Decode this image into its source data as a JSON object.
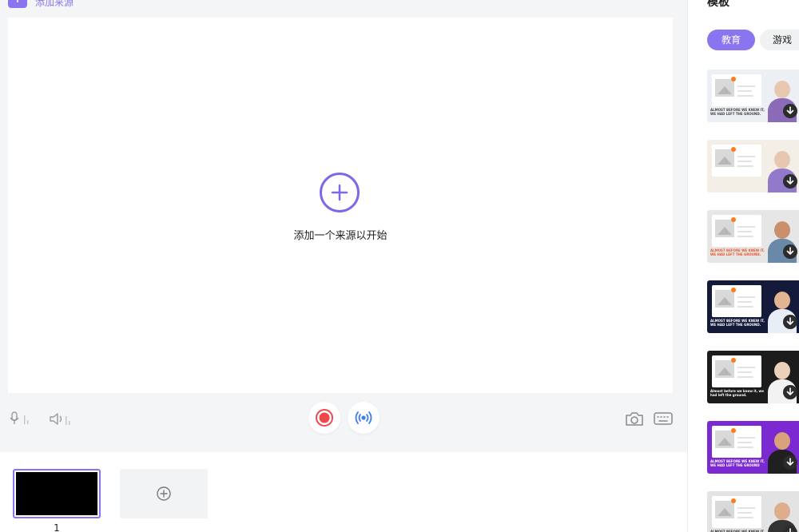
{
  "top": {
    "add_source_label": "添加来源"
  },
  "canvas": {
    "hint": "添加一个来源以开始"
  },
  "scenes": [
    {
      "number": "1"
    }
  ],
  "right_panel": {
    "title": "模板",
    "tabs": [
      {
        "label": "教育",
        "active": true
      },
      {
        "label": "游戏",
        "active": false
      }
    ],
    "templates": [
      {
        "bg": "#eceff3",
        "caption": "ALMOST BEFORE WE KNEW IT, WE HAD LEFT THE GROUND.",
        "caption_color": "#444",
        "skin": "#e8c9b0",
        "shirt": "#8b6bb8"
      },
      {
        "bg": "#f3efe6",
        "caption": "",
        "caption_color": "#444",
        "skin": "#e6c8b2",
        "shirt": "#9279c9"
      },
      {
        "bg": "#e6e6e6",
        "caption": "ALMOST BEFORE WE KNEW IT, WE HAD LEFT THE GROUND.",
        "caption_color": "#e8572b",
        "skin": "#c9906b",
        "shirt": "#6a88a8"
      },
      {
        "bg": "#141a3a",
        "caption": "ALMOST BEFORE WE KNEW IT, WE HAD LEFT THE GROUND.",
        "caption_color": "#ffffff",
        "skin": "#e1b591",
        "shirt": "#e9eef6"
      },
      {
        "bg": "#1c1c1c",
        "caption": "Almost before we knew it, we had left the ground.",
        "caption_color": "#ffffff",
        "skin": "#ecd0b8",
        "shirt": "#f2f2f2"
      },
      {
        "bg": "#7a2ad0",
        "caption": "ALMOST BEFORE WE KNEW IT, WE HAD LEFT THE GROUND",
        "caption_color": "#ffffff",
        "skin": "#d9a27a",
        "shirt": "#202020"
      },
      {
        "bg": "#e3e3e3",
        "caption": "ALMOST BEFORE WE KNEW IT, WE HAD LEFT THE GROUND.",
        "caption_color": "#333",
        "skin": "#dcae8c",
        "shirt": "#333333"
      }
    ]
  }
}
